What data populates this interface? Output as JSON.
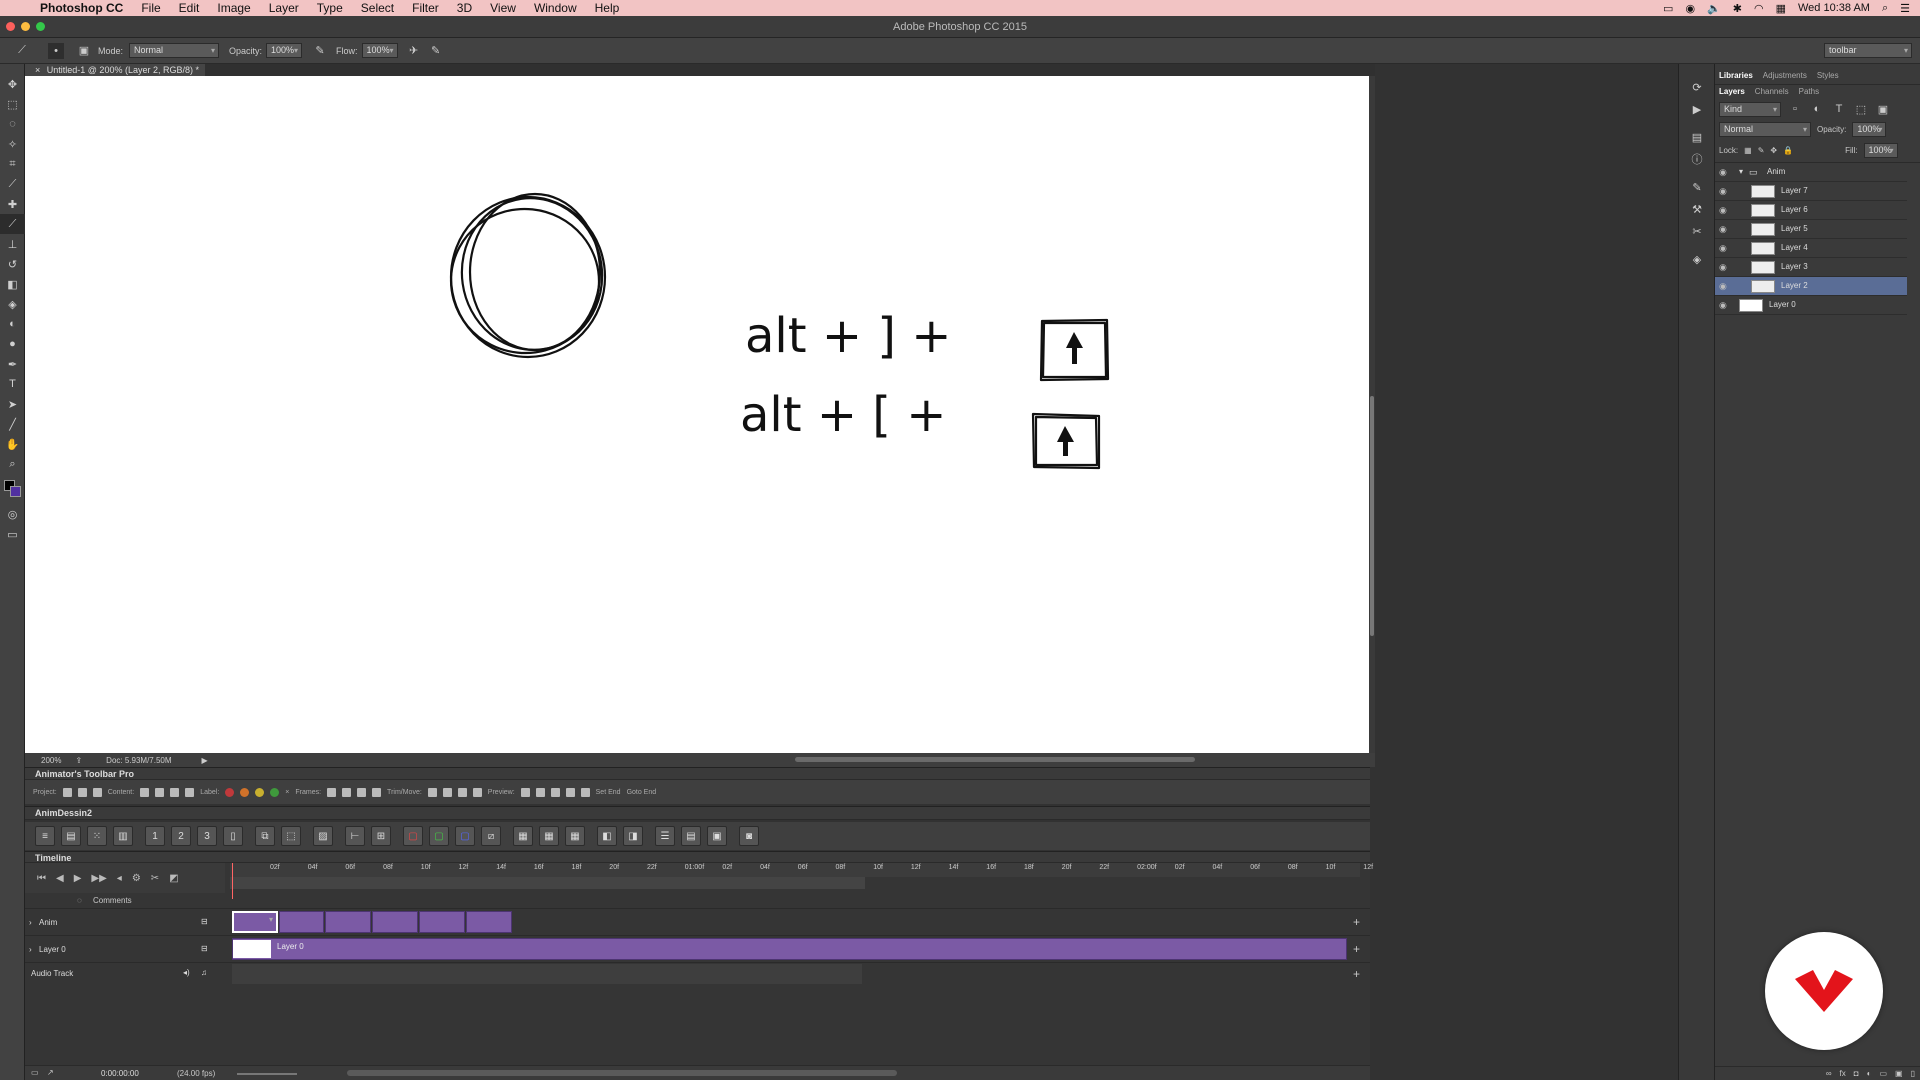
{
  "menubar": {
    "app": "Photoshop CC",
    "items": [
      "File",
      "Edit",
      "Image",
      "Layer",
      "Type",
      "Select",
      "Filter",
      "3D",
      "View",
      "Window",
      "Help"
    ],
    "clock": "Wed 10:38 AM"
  },
  "titlebar": {
    "title": "Adobe Photoshop CC 2015"
  },
  "options": {
    "mode_label": "Mode:",
    "mode_value": "Normal",
    "opacity_label": "Opacity:",
    "opacity_value": "100%",
    "flow_label": "Flow:",
    "flow_value": "100%",
    "workspace": "toolbar"
  },
  "document": {
    "tab": "Untitled-1 @ 200% (Layer 2, RGB/8) *"
  },
  "canvas_text": {
    "line1": "alt + ] + ",
    "line2": "alt + [ + "
  },
  "status": {
    "zoom": "200%",
    "doc": "Doc: 5.93M/7.50M"
  },
  "animator_pro": {
    "title": "Animator's Toolbar Pro",
    "project": "Project:",
    "content": "Content:",
    "label": "Label:",
    "frames": "Frames:",
    "trimmove": "Trim/Move:",
    "preview": "Preview:",
    "set_end": "Set End",
    "goto_end": "Goto End"
  },
  "animdessin": {
    "title": "AnimDessin2"
  },
  "timeline": {
    "title": "Timeline",
    "ruler": [
      "02f",
      "04f",
      "06f",
      "08f",
      "10f",
      "12f",
      "14f",
      "16f",
      "18f",
      "20f",
      "22f",
      "01:00f",
      "02f",
      "04f",
      "06f",
      "08f",
      "10f",
      "12f",
      "14f",
      "16f",
      "18f",
      "20f",
      "22f",
      "02:00f",
      "02f",
      "04f",
      "06f",
      "08f",
      "10f",
      "12f"
    ],
    "comments": "Comments",
    "tracks": [
      "Anim",
      "Layer 0",
      "Audio Track"
    ],
    "layer0_clip": "Layer 0",
    "timecode": "0:00:00:00",
    "fps": "(24.00 fps)"
  },
  "panels": {
    "top_tabs": [
      "Libraries",
      "Adjustments",
      "Styles"
    ],
    "layer_tabs": [
      "Layers",
      "Channels",
      "Paths"
    ],
    "kind": "Kind",
    "blend": "Normal",
    "opacity_label": "Opacity:",
    "opacity_value": "100%",
    "lock_label": "Lock:",
    "fill_label": "Fill:",
    "fill_value": "100%",
    "group": "Anim",
    "layers": [
      "Layer 7",
      "Layer 6",
      "Layer 5",
      "Layer 4",
      "Layer 3",
      "Layer 2"
    ],
    "bottom_layer": "Layer 0",
    "selected_layer": "Layer 2"
  },
  "colors": {
    "clip_purple": "#7b5aa5",
    "selection_blue": "#5a6d96",
    "logo_red": "#e3141b"
  }
}
